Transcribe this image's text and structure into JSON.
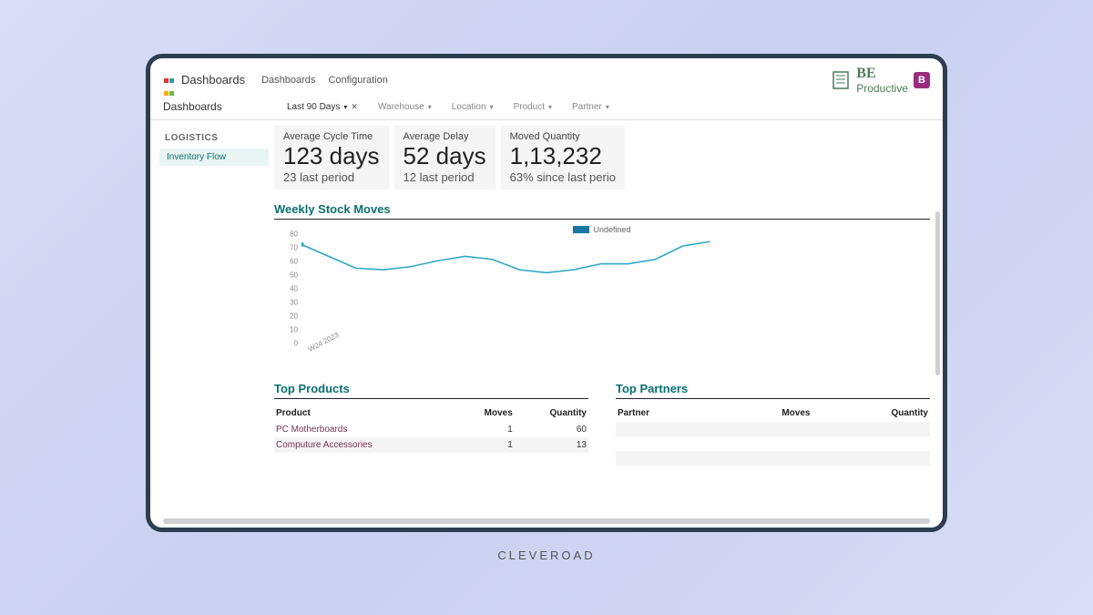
{
  "topnav": {
    "app_title": "Dashboards",
    "links": [
      "Dashboards",
      "Configuration"
    ]
  },
  "logo": {
    "be": "BE",
    "productive": "Productive",
    "badge": "B"
  },
  "breadcrumb": "Dashboards",
  "filters": [
    {
      "label": "Last 90 Days",
      "active": true,
      "closable": true
    },
    {
      "label": "Warehouse",
      "active": false
    },
    {
      "label": "Location",
      "active": false
    },
    {
      "label": "Product",
      "active": false
    },
    {
      "label": "Partner",
      "active": false
    }
  ],
  "sidebar": {
    "heading": "LOGISTICS",
    "items": [
      "Inventory Flow"
    ]
  },
  "kpis": [
    {
      "label": "Average Cycle Time",
      "value": "123 days",
      "sub": "23 last period"
    },
    {
      "label": "Average Delay",
      "value": "52 days",
      "sub": "12 last period"
    },
    {
      "label": "Moved Quantity",
      "value": "1,13,232",
      "sub": "63% since last perio"
    }
  ],
  "chart_section_title": "Weekly Stock Moves",
  "chart_data": {
    "type": "line",
    "title": "Weekly Stock Moves",
    "series": [
      {
        "name": "Undefined",
        "values": [
          73,
          65,
          57,
          56,
          58,
          62,
          65,
          63,
          56,
          54,
          56,
          60,
          60,
          63,
          72,
          75
        ]
      }
    ],
    "x_start_label": "W24 2023",
    "yticks": [
      0,
      10,
      20,
      30,
      40,
      50,
      60,
      70,
      80
    ],
    "ylim": [
      0,
      80
    ],
    "xlabel": "",
    "ylabel": ""
  },
  "top_products": {
    "title": "Top Products",
    "columns": [
      "Product",
      "Moves",
      "Quantity"
    ],
    "rows": [
      {
        "product": "PC Motherboards",
        "moves": 1,
        "quantity": 60
      },
      {
        "product": "Computure Accessories",
        "moves": 1,
        "quantity": 13
      }
    ]
  },
  "top_partners": {
    "title": "Top Partners",
    "columns": [
      "Partner",
      "Moves",
      "Quantity"
    ],
    "rows": []
  },
  "footer_brand": "CLEVEROAD"
}
